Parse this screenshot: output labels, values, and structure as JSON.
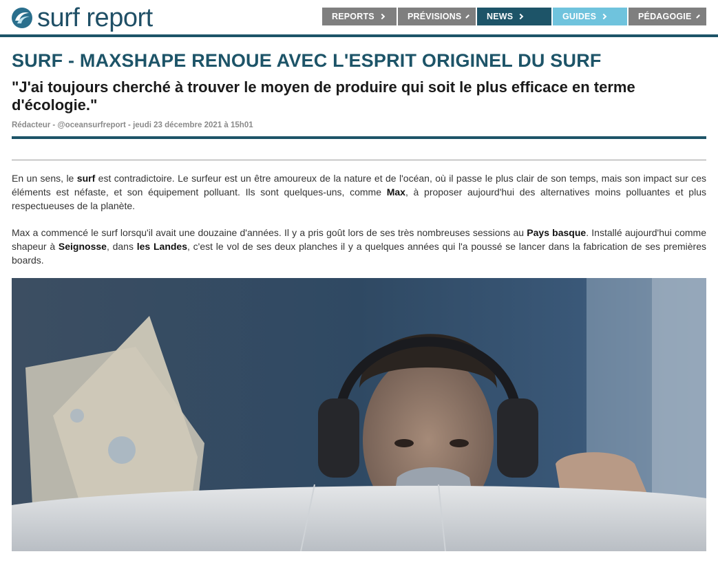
{
  "logo": {
    "text": "surf report",
    "icon": "wave-logo-icon"
  },
  "nav": {
    "items": [
      {
        "label": "REPORTS",
        "color": "#7f7f7f"
      },
      {
        "label": "PRÉVISIONS",
        "color": "#7f7f7f"
      },
      {
        "label": "NEWS",
        "color": "#1d5468"
      },
      {
        "label": "GUIDES",
        "color": "#6fc3dd"
      },
      {
        "label": "PÉDAGOGIE",
        "color": "#7f7f7f"
      }
    ]
  },
  "article": {
    "title": "SURF - MAXSHAPE RENOUE AVEC L'ESPRIT ORIGINEL DU SURF",
    "subtitle": "\"J'ai toujours cherché à trouver le moyen de produire qui soit le plus efficace en terme d'écologie.\"",
    "meta": "Rédacteur - @oceansurfreport - jeudi 23 décembre 2021 à 15h01",
    "p1": {
      "a": "En un sens, le ",
      "b": "surf",
      "c": " est contradictoire. Le surfeur est un être amoureux de la nature et de l'océan, où il passe le plus clair de son temps, mais son impact sur ces éléments est néfaste, et son équipement polluant. Ils sont quelques-uns, comme ",
      "d": "Max",
      "e": ", à proposer aujourd'hui des alternatives moins polluantes et plus respectueuses de la planète."
    },
    "p2": {
      "a": "Max a commencé le surf lorsqu'il avait une douzaine d'années. Il y a pris goût lors de ses très nombreuses sessions au ",
      "b": "Pays basque",
      "c": ". Installé aujourd'hui comme shapeur à ",
      "d": "Seignosse",
      "e": ", dans ",
      "f": "les Landes",
      "g": ", c'est le vol de ses deux planches il y a quelques années qui l'a poussé se lancer dans la fabrication de ses premières boards."
    }
  },
  "colors": {
    "brand": "#1d5468",
    "accent": "#6fc3dd",
    "nav_grey": "#7f7f7f"
  }
}
